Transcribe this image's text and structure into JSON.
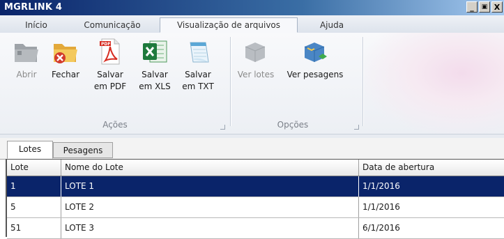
{
  "window": {
    "title": "MGRLINK 4",
    "controls": [
      "_",
      "В",
      "X"
    ]
  },
  "ribbon_tabs": [
    {
      "label": "Início",
      "active": false
    },
    {
      "label": "Comunicação",
      "active": false
    },
    {
      "label": "Visualização de arquivos",
      "active": true
    },
    {
      "label": "Ajuda",
      "active": false
    }
  ],
  "ribbon": {
    "groups": {
      "acoes": "Ações",
      "opcoes": "Opções"
    },
    "buttons": {
      "abrir": {
        "line1": "Abrir",
        "line2": "",
        "icon": "folder-open-icon",
        "enabled": false
      },
      "fechar": {
        "line1": "Fechar",
        "line2": "",
        "icon": "folder-close-icon",
        "enabled": true
      },
      "pdf": {
        "line1": "Salvar",
        "line2": "em PDF",
        "icon": "pdf-icon",
        "enabled": true
      },
      "xls": {
        "line1": "Salvar",
        "line2": "em XLS",
        "icon": "excel-icon",
        "enabled": true
      },
      "txt": {
        "line1": "Salvar",
        "line2": "em TXT",
        "icon": "notepad-icon",
        "enabled": true
      },
      "ver_lotes": {
        "line1": "Ver lotes",
        "line2": "",
        "icon": "lots-icon",
        "enabled": false
      },
      "ver_pesagens": {
        "line1": "Ver pesagens",
        "line2": "",
        "icon": "weighings-icon",
        "enabled": true
      }
    }
  },
  "sub_tabs": [
    {
      "label": "Lotes",
      "active": true
    },
    {
      "label": "Pesagens",
      "active": false
    }
  ],
  "table": {
    "columns": [
      "Lote",
      "Nome do Lote",
      "Data de abertura"
    ],
    "rows": [
      {
        "lote": "1",
        "nome": "LOTE 1",
        "data": "1/1/2016",
        "selected": true
      },
      {
        "lote": "5",
        "nome": "LOTE 2",
        "data": "1/1/2016",
        "selected": false
      },
      {
        "lote": "51",
        "nome": "LOTE 3",
        "data": "6/1/2016",
        "selected": false
      }
    ]
  },
  "colors": {
    "titlebar": "#0a246a",
    "selection": "#0a246a",
    "excel_green": "#1e7a3c",
    "pdf_red": "#d62b20"
  }
}
